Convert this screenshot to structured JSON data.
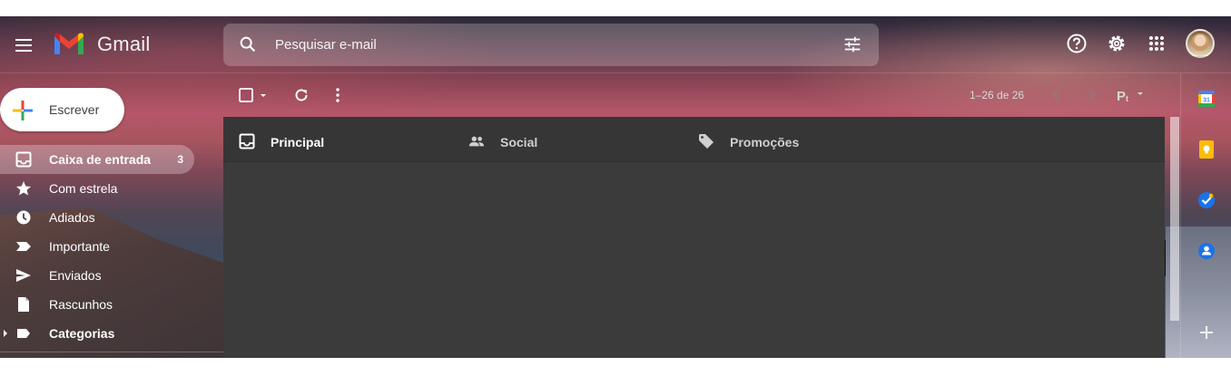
{
  "app": {
    "brand": "Gmail"
  },
  "search": {
    "placeholder": "Pesquisar e-mail"
  },
  "compose": {
    "label": "Escrever"
  },
  "sidebar": {
    "items": [
      {
        "label": "Caixa de entrada",
        "count": "3",
        "icon": "inbox-icon",
        "active": true
      },
      {
        "label": "Com estrela",
        "icon": "star-icon"
      },
      {
        "label": "Adiados",
        "icon": "clock-icon"
      },
      {
        "label": "Importante",
        "icon": "important-icon"
      },
      {
        "label": "Enviados",
        "icon": "send-icon"
      },
      {
        "label": "Rascunhos",
        "icon": "draft-icon"
      },
      {
        "label": "Categorias",
        "icon": "label-icon"
      }
    ]
  },
  "toolbar": {
    "pagination": "1–26 de 26"
  },
  "tabs": [
    {
      "label": "Principal",
      "icon": "inbox-icon",
      "active": true
    },
    {
      "label": "Social",
      "icon": "people-icon"
    },
    {
      "label": "Promoções",
      "icon": "tag-icon"
    }
  ],
  "colors": {
    "panel": "#3b3b3b",
    "compose_bg": "#ffffff",
    "calendar": "#4285f4",
    "keep": "#fbbc04",
    "tasks": "#1a73e8",
    "contacts": "#1a73e8"
  }
}
